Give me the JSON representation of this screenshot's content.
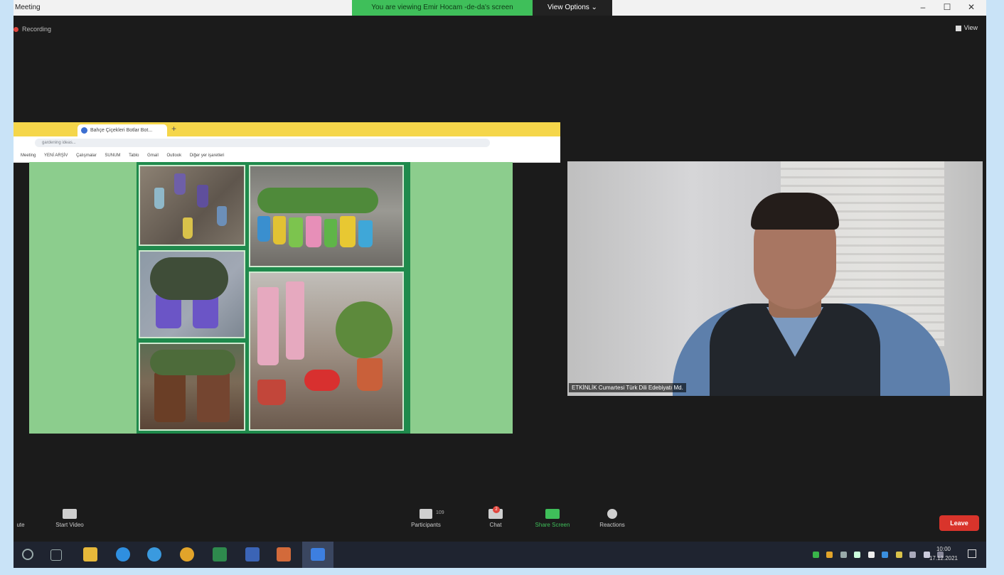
{
  "window": {
    "title": "Meeting",
    "share_banner": "You are viewing Emir Hocam -de-da's screen",
    "view_options": "View Options ⌄",
    "controls": [
      "–",
      "☐",
      "✕"
    ]
  },
  "recording": {
    "label": "Recording"
  },
  "view_button": {
    "label": "View"
  },
  "shared_screen": {
    "tab_title": "Bahçe Çiçekleri Botlar Bot...",
    "new_tab": "+",
    "url": "gardening ideas...",
    "bookmarks": [
      "Meeting",
      "YENİ ARŞİV",
      "Çalışmalar",
      "SUNUM",
      "Tablo",
      "Gmail",
      "Outlook",
      "Diğer yer işaretleri"
    ]
  },
  "camera": {
    "name_label": "ETKİNLİK Cumartesi Türk Dili Edebiyatı Md."
  },
  "toolbar": {
    "mute_label": "ute",
    "video_label": "Start Video",
    "participants_label": "Participants",
    "participants_count": "109",
    "chat_label": "Chat",
    "chat_badge": "2",
    "share_label": "Share Screen",
    "reactions_label": "Reactions",
    "leave_label": "Leave"
  },
  "taskbar": {
    "icons": [
      "search-icon",
      "task-view-icon",
      "file-explorer-icon",
      "edge-icon",
      "ie-icon",
      "chrome-icon",
      "excel-icon",
      "word-icon",
      "powerpoint-icon",
      "zoom-icon"
    ],
    "time": "10:00",
    "date": "17.12.2021"
  },
  "colors": {
    "share_green": "#3fbf5a",
    "leave_red": "#d9342b",
    "slide_green": "#8ccd8d",
    "chrome_yellow": "#f5d64a"
  }
}
